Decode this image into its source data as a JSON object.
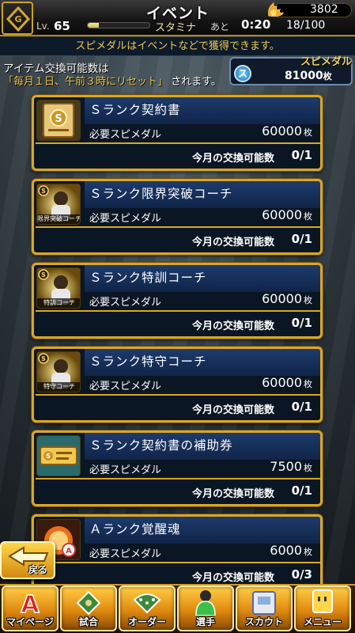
{
  "header": {
    "title": "イベント",
    "level_label": "Lv.",
    "level": "65",
    "stamina_label": "スタミナ",
    "stamina_fraction": 0.18,
    "stamina_after_label": "あと",
    "stamina_timer": "0:20",
    "stamina_count": "18/100",
    "coins": "3802"
  },
  "notice": "スピメダルはイベントなどで獲得できます。",
  "info": {
    "line1": "アイテム交換可能数は",
    "line2_em": "「毎月１日、午前３時にリセット」",
    "line2_rest": "されます。"
  },
  "medal": {
    "label": "スピメダル",
    "icon_letter": "ス",
    "value": "81000",
    "unit": "枚"
  },
  "card_labels": {
    "cost_label": "必要スピメダル",
    "unit": "枚",
    "limit_label": "今月の交換可能数"
  },
  "items": [
    {
      "name": "Ｓランク契約書",
      "cost": "60000",
      "limit": "0/1",
      "icon": "contract-s-icon",
      "caption": ""
    },
    {
      "name": "Ｓランク限界突破コーチ",
      "cost": "60000",
      "limit": "0/1",
      "icon": "coach-player-icon",
      "caption": "限界突破コーチ"
    },
    {
      "name": "Ｓランク特訓コーチ",
      "cost": "60000",
      "limit": "0/1",
      "icon": "coach-player-icon",
      "caption": "特訓コーチ"
    },
    {
      "name": "Ｓランク特守コーチ",
      "cost": "60000",
      "limit": "0/1",
      "icon": "coach-player-icon",
      "caption": "特守コーチ"
    },
    {
      "name": "Ｓランク契約書の補助券",
      "cost": "7500",
      "limit": "0/1",
      "icon": "ticket-icon",
      "caption": ""
    },
    {
      "name": "Ａランク覚醒魂",
      "cost": "6000",
      "limit": "0/3",
      "icon": "awakening-soul-icon",
      "caption": ""
    }
  ],
  "back_label": "戻る",
  "nav": [
    {
      "label": "マイページ",
      "icon": "mypage-icon"
    },
    {
      "label": "試合",
      "icon": "match-icon"
    },
    {
      "label": "オーダー",
      "icon": "order-icon"
    },
    {
      "label": "選手",
      "icon": "player-icon"
    },
    {
      "label": "スカウト",
      "icon": "scout-icon"
    },
    {
      "label": "メニュー",
      "icon": "menu-icon"
    }
  ],
  "colors": {
    "accent_gold": "#d7a72a",
    "header_blue": "#1e3b6c",
    "notice_yellow": "#f0c850"
  }
}
